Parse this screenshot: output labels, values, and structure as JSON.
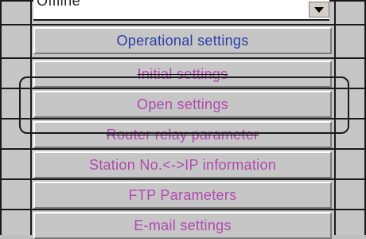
{
  "dropdown": {
    "value": "Offline"
  },
  "buttons": [
    {
      "label": "Operational settings",
      "color": "#2a3ea8"
    },
    {
      "label": "Initial settings",
      "color": "#b04ab0"
    },
    {
      "label": "Open settings",
      "color": "#b04ab0"
    },
    {
      "label": "Router relay parameter",
      "color": "#b04ab0"
    },
    {
      "label": "Station No.<->IP information",
      "color": "#b04ab0"
    },
    {
      "label": "FTP Parameters",
      "color": "#b04ab0"
    },
    {
      "label": "E-mail settings",
      "color": "#b04ab0"
    }
  ]
}
